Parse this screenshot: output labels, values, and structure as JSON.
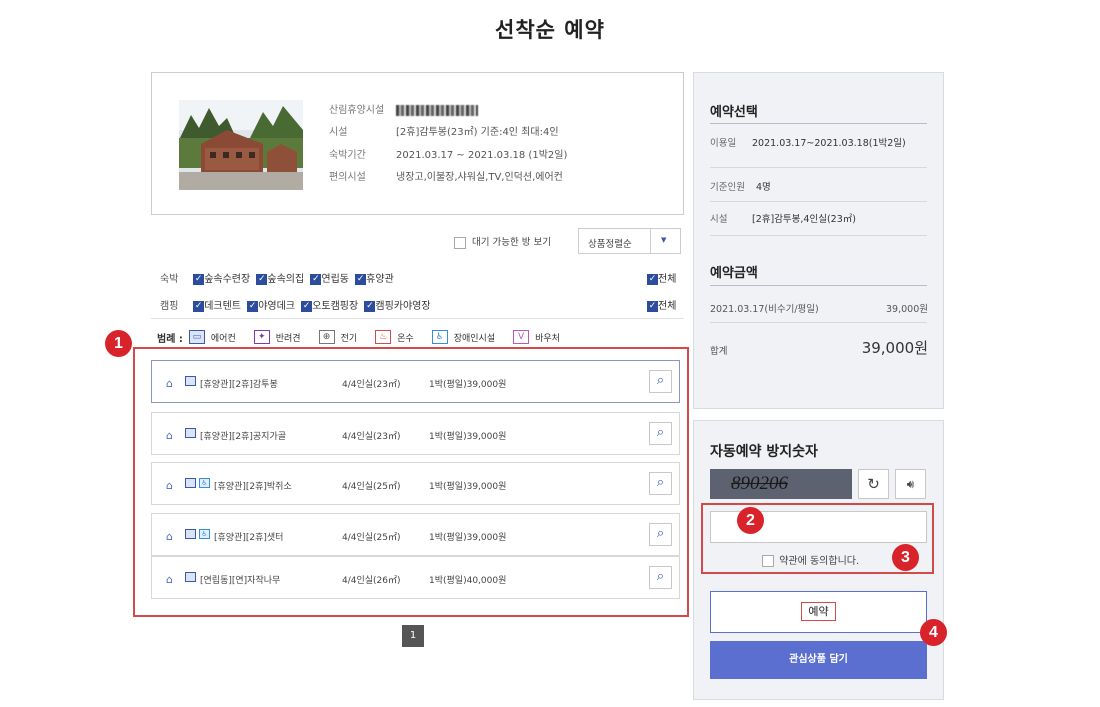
{
  "page_title": "선착순 예약",
  "facility": {
    "labels": {
      "name": "산림휴양시설",
      "facility": "시설",
      "period": "숙박기간",
      "amenities": "편의시설"
    },
    "facility_value": "[2휴]감투봉(23㎡) 기준:4인 최대:4인",
    "period_value": "2021.03.17 ~ 2021.03.18 (1박2일)",
    "amenities_value": "냉장고,이불장,샤워실,TV,인덕션,에어컨"
  },
  "controls": {
    "waitlist_label": "대기 가능한 방 보기",
    "sort_label": "상품정렬순",
    "sort_arrow": "▼"
  },
  "filters": {
    "lodging": {
      "tag": "숙박",
      "items": [
        "숲속수련장",
        "숲속의집",
        "연립동",
        "휴양관"
      ],
      "all_label": "전체"
    },
    "camping": {
      "tag": "캠핑",
      "items": [
        "데크텐트",
        "야영데크",
        "오토캠핑장",
        "캠핑카야영장"
      ],
      "all_label": "전체"
    }
  },
  "legend": {
    "title": "범례 :",
    "items": [
      {
        "label": "에어컨",
        "icon": "aircon-icon",
        "color": "#3a5aa8"
      },
      {
        "label": "반려견",
        "icon": "pet-icon",
        "color": "#7a3ab0"
      },
      {
        "label": "전기",
        "icon": "electric-icon",
        "color": "#555555"
      },
      {
        "label": "온수",
        "icon": "hotwater-icon",
        "color": "#d24a4a"
      },
      {
        "label": "장애인시설",
        "icon": "accessible-icon",
        "color": "#3a8ed8"
      },
      {
        "label": "바우처",
        "icon": "voucher-icon",
        "color": "#c055c0"
      }
    ]
  },
  "rooms": [
    {
      "name": "[휴양관][2휴]감투봉",
      "capacity": "4/4인실(23㎡)",
      "price": "1박(평일)39,000원"
    },
    {
      "name": "[휴양관][2휴]공지가골",
      "capacity": "4/4인실(23㎡)",
      "price": "1박(평일)39,000원"
    },
    {
      "name": "[휴양관][2휴]박쥐소",
      "capacity": "4/4인실(25㎡)",
      "price": "1박(평일)39,000원"
    },
    {
      "name": "[휴양관][2휴]샛터",
      "capacity": "4/4인실(25㎡)",
      "price": "1박(평일)39,000원"
    },
    {
      "name": "[연립동][연]자작나무",
      "capacity": "4/4인실(26㎡)",
      "price": "1박(평일)40,000원"
    }
  ],
  "pagination": {
    "current": "1"
  },
  "summary": {
    "heading": "예약선택",
    "rows": [
      {
        "label": "이용일",
        "value": "2021.03.17~2021.03.18(1박2일)"
      },
      {
        "label": "기준인원",
        "value": "4명"
      },
      {
        "label": "시설",
        "value": "[2휴]감투봉,4인실(23㎡)"
      }
    ],
    "price_heading": "예약금액",
    "price_row": {
      "label": "2021.03.17(비수기/평일)",
      "value": "39,000원"
    },
    "total": {
      "label": "합계",
      "value": "39,000원"
    }
  },
  "captcha": {
    "heading": "자동예약 방지숫자",
    "code": "890206",
    "input_value": "",
    "agree_label": "약관에 동의합니다."
  },
  "actions": {
    "reserve_label": "예약",
    "wishlist_label": "관심상품 담기"
  },
  "markers": [
    "1",
    "2",
    "3",
    "4"
  ],
  "colors": {
    "accent": "#5b6fd0",
    "marker": "#d8232a",
    "highlight_border": "#d24a4a"
  }
}
